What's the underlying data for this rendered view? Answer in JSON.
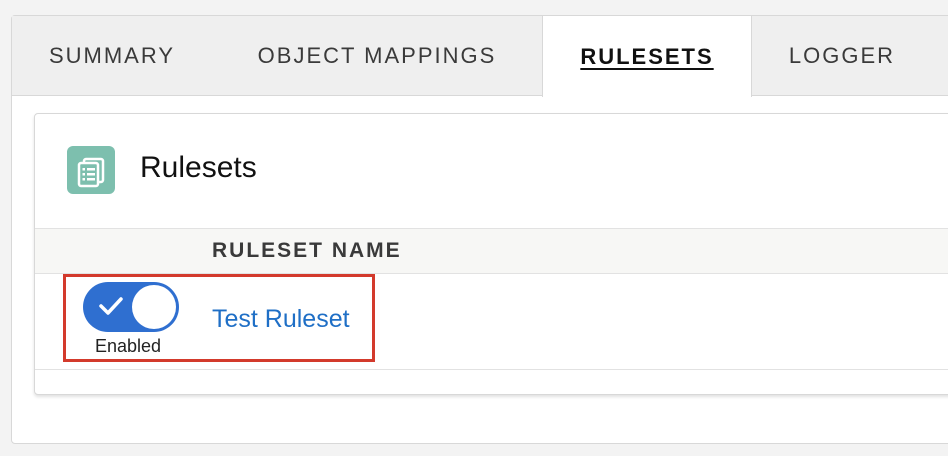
{
  "tabs": [
    {
      "label": "SUMMARY",
      "active": false
    },
    {
      "label": "OBJECT MAPPINGS",
      "active": false
    },
    {
      "label": "RULESETS",
      "active": true
    },
    {
      "label": "LOGGER",
      "active": false
    }
  ],
  "card": {
    "title": "Rulesets",
    "icon": "list-document-icon",
    "icon_color": "#7dbfae"
  },
  "table": {
    "columns": [
      "RULESET NAME"
    ],
    "rows": [
      {
        "enabled": true,
        "toggle_label": "Enabled",
        "name": "Test Ruleset"
      }
    ]
  },
  "colors": {
    "toggle_on": "#2f6fd0",
    "link": "#1f6fc6",
    "highlight": "#d33a2c"
  }
}
